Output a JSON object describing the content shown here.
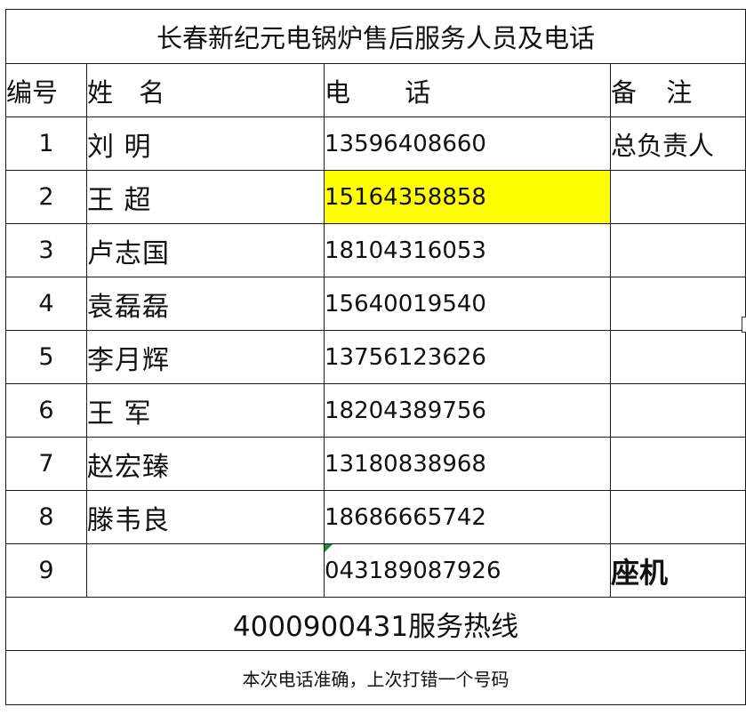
{
  "title": "长春新纪元电锅炉售后服务人员及电话",
  "headers": {
    "num": "编号",
    "name": "姓 名",
    "phone": "电 话",
    "note": "备 注"
  },
  "rows": [
    {
      "num": "1",
      "name": "刘 明",
      "phone": "13596408660",
      "note": "总负责人"
    },
    {
      "num": "2",
      "name": "王 超",
      "phone": "15164358858",
      "note": ""
    },
    {
      "num": "3",
      "name": "卢志国",
      "phone": "18104316053",
      "note": ""
    },
    {
      "num": "4",
      "name": "袁磊磊",
      "phone": "15640019540",
      "note": ""
    },
    {
      "num": "5",
      "name": "李月辉",
      "phone": "13756123626",
      "note": ""
    },
    {
      "num": "6",
      "name": "王 军",
      "phone": "18204389756",
      "note": ""
    },
    {
      "num": "7",
      "name": "赵宏臻",
      "phone": "13180838968",
      "note": ""
    },
    {
      "num": "8",
      "name": "滕韦良",
      "phone": "18686665742",
      "note": ""
    },
    {
      "num": "9",
      "name": "",
      "phone": "043189087926",
      "note": "座机"
    }
  ],
  "hotline": "4000900431服务热线",
  "footnote": "本次电话准确，上次打错一个号码",
  "colors": {
    "highlight": "#ffff00",
    "comment_marker": "#1f8a3a",
    "border": "#1a1a1a"
  }
}
